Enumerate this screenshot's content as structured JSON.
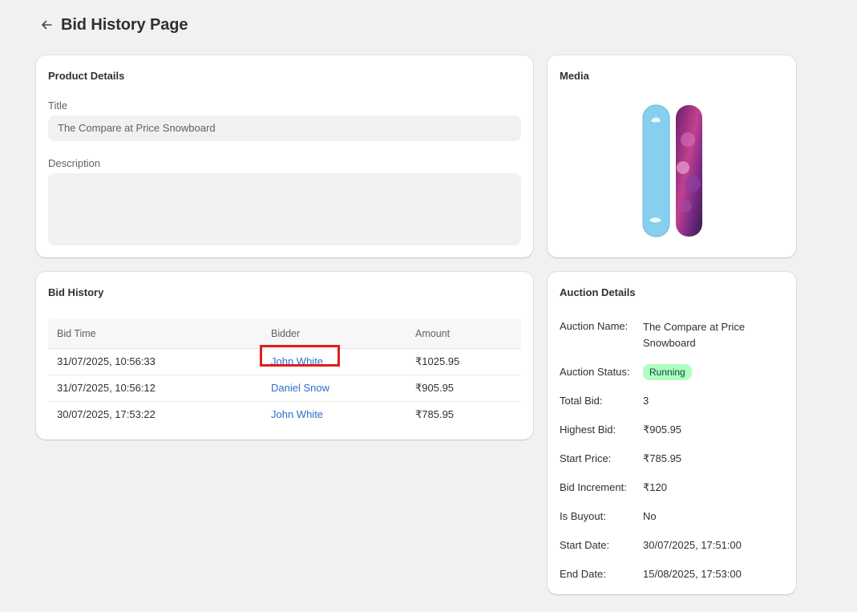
{
  "header": {
    "title": "Bid History Page",
    "back_icon": "arrow-left-icon"
  },
  "product": {
    "section_title": "Product Details",
    "title_label": "Title",
    "title_value": "The Compare at Price Snowboard",
    "description_label": "Description",
    "description_value": ""
  },
  "media": {
    "section_title": "Media",
    "image": "snowboard-product-image"
  },
  "bid_history": {
    "section_title": "Bid History",
    "columns": [
      "Bid Time",
      "Bidder",
      "Amount"
    ],
    "rows": [
      {
        "time": "31/07/2025, 10:56:33",
        "bidder": "John White",
        "amount": "₹1025.95"
      },
      {
        "time": "31/07/2025, 10:56:12",
        "bidder": "Daniel Snow",
        "amount": "₹905.95"
      },
      {
        "time": "30/07/2025, 17:53:22",
        "bidder": "John White",
        "amount": "₹785.95"
      }
    ]
  },
  "auction": {
    "section_title": "Auction Details",
    "name_label": "Auction Name:",
    "name_value": "The Compare at Price Snowboard",
    "status_label": "Auction Status:",
    "status_value": "Running",
    "total_bid_label": "Total Bid:",
    "total_bid_value": "3",
    "highest_bid_label": "Highest Bid:",
    "highest_bid_value": "₹905.95",
    "start_price_label": "Start Price:",
    "start_price_value": "₹785.95",
    "increment_label": "Bid Increment:",
    "increment_value": "₹120",
    "buyout_label": "Is Buyout:",
    "buyout_value": "No",
    "start_date_label": "Start Date:",
    "start_date_value": "30/07/2025, 17:51:00",
    "end_date_label": "End Date:",
    "end_date_value": "15/08/2025, 17:53:00"
  },
  "colors": {
    "link": "#2c6ecb",
    "highlight": "#e11d1d",
    "badge_bg": "#affebf",
    "background": "#f1f1f1"
  }
}
